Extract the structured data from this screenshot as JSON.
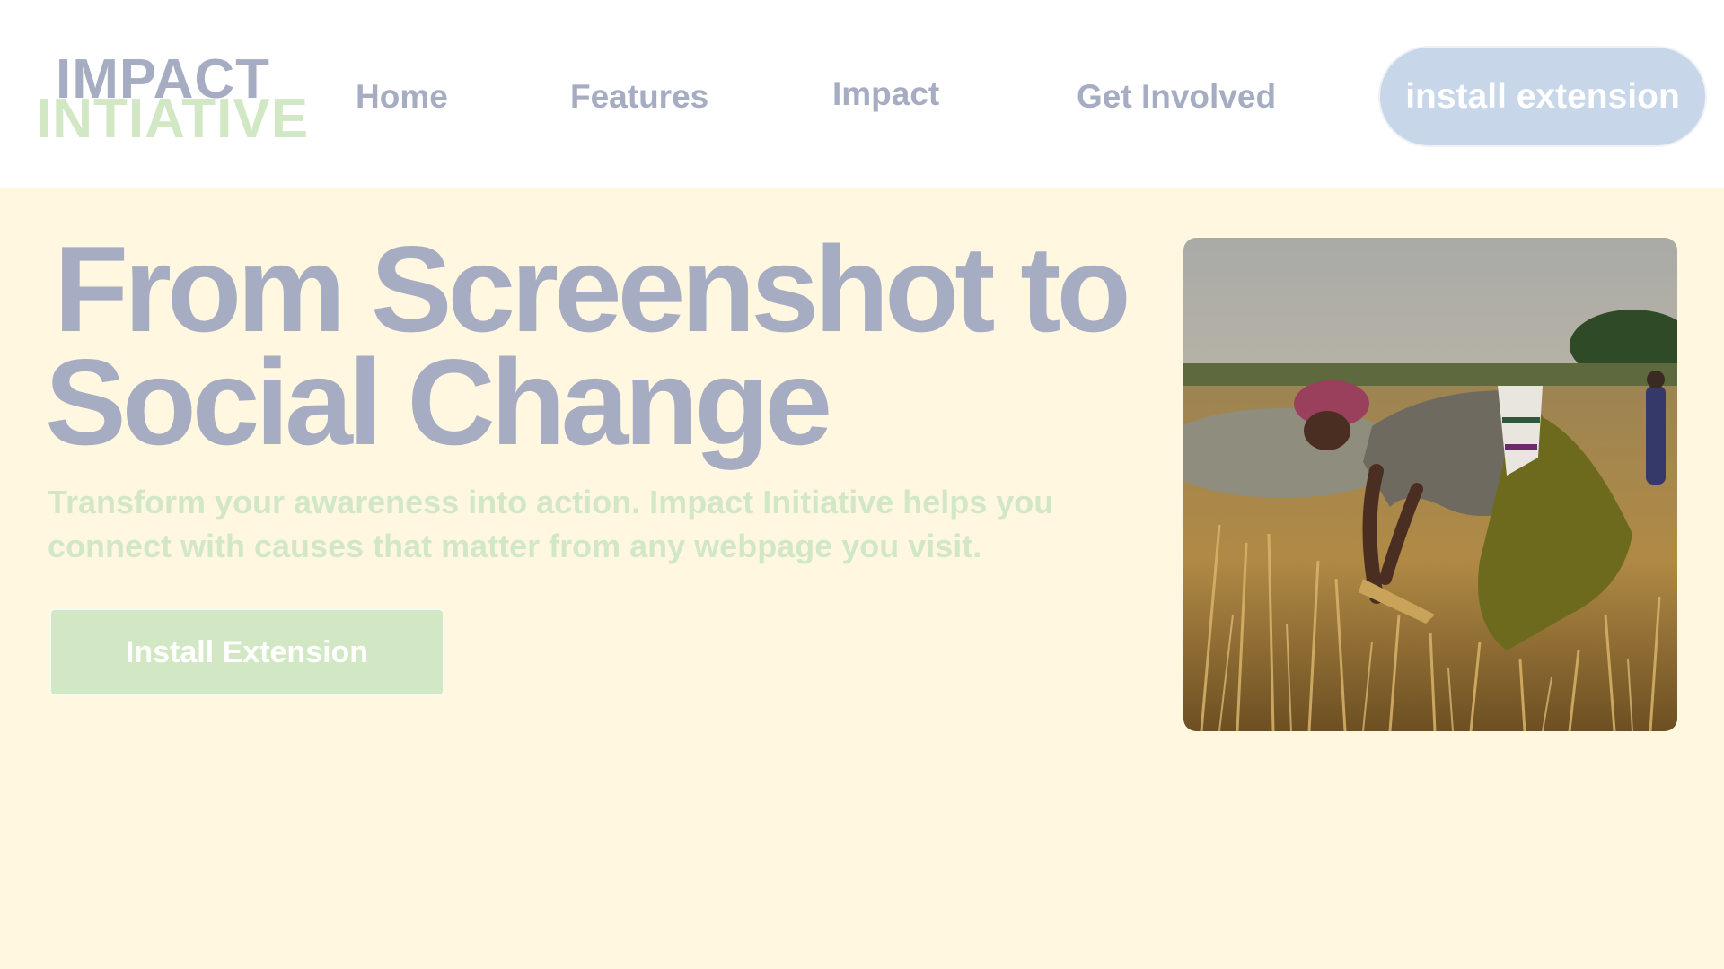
{
  "brand": {
    "line1": "IMPACT",
    "line2": "INTIATIVE"
  },
  "nav": {
    "items": [
      "Home",
      "Features",
      "Impact",
      "Get Involved"
    ],
    "cta_label": "install extension"
  },
  "hero": {
    "title_line1": "From Screenshot to",
    "title_line2": "Social Change",
    "subtitle": "Transform your awareness into action. Impact Initiative helps you connect with causes that matter from any webpage you visit.",
    "button_label": "Install Extension",
    "image_description_icon": "photo-farmer-harvesting-wheat"
  },
  "colors": {
    "header_bg": "#ffffff",
    "hero_bg": "#fff7df",
    "title_gray": "#a6adc3",
    "accent_green": "#d2e8c5",
    "pill_blue": "#c7d6e9"
  }
}
